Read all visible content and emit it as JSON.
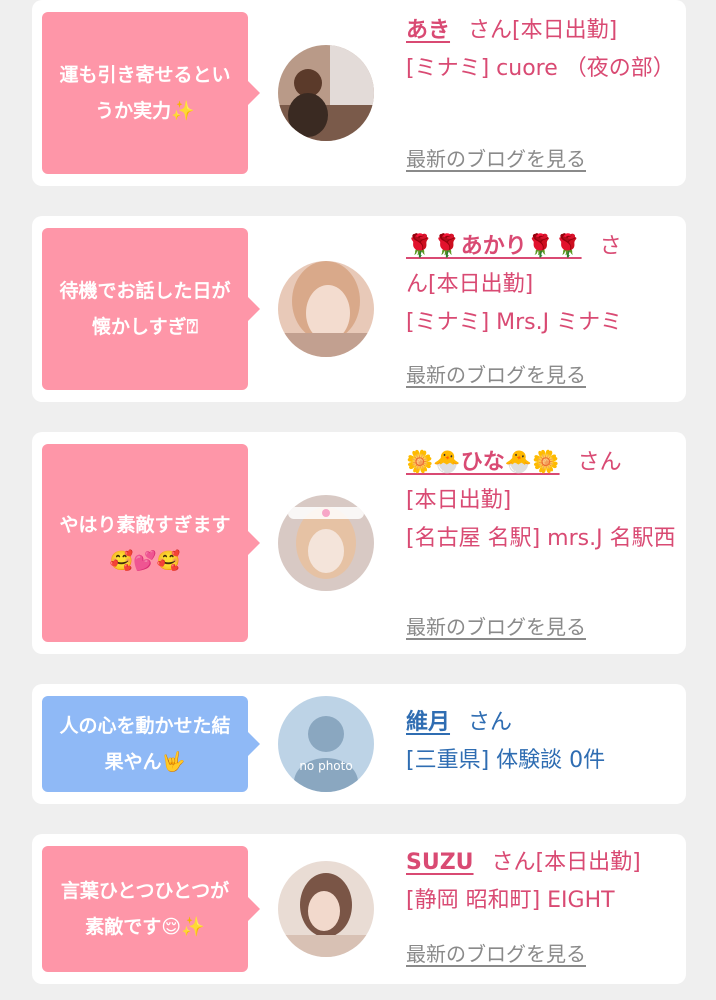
{
  "reviews": [
    {
      "comment": "運も引き寄せるというか実力✨",
      "name": "あき",
      "san": "さん",
      "status": "[本日出勤]",
      "shop": "[ミナミ] cuore （夜の部）",
      "blog_link": "最新のブログを見る"
    },
    {
      "comment": "待機でお話した日が懐かしすぎ⍰",
      "name": "🌹🌹あかり🌹🌹",
      "san": "さ",
      "status": "ん[本日出勤]",
      "shop": "[ミナミ] Mrs.J ミナミ",
      "blog_link": "最新のブログを見る"
    },
    {
      "comment": "やはり素敵すぎます🥰💕🥰",
      "name": "🌼🐣ひな🐣🌼",
      "san": "さん",
      "status": "[本日出勤]",
      "shop": "[名古屋 名駅] mrs.J 名駅西",
      "blog_link": "最新のブログを見る"
    },
    {
      "comment": "人の心を動かせた結果やん🤟",
      "name": "維月",
      "san": "さん",
      "status": "[三重県] 体験談 0件",
      "avatar_text": "no photo"
    },
    {
      "comment": "言葉ひとつひとつが素敵です😌✨",
      "name": "SUZU",
      "san": "さん[本日出勤]",
      "status": "[静岡 昭和町] EIGHT",
      "blog_link": "最新のブログを見る"
    }
  ],
  "colors": {
    "pink_bubble": "#fe96a8",
    "blue_bubble": "#8fb9f6",
    "pink_text": "#d94a73",
    "blue_text": "#2f6db2",
    "gray_link": "#8a8a8a",
    "background": "#efefef"
  }
}
